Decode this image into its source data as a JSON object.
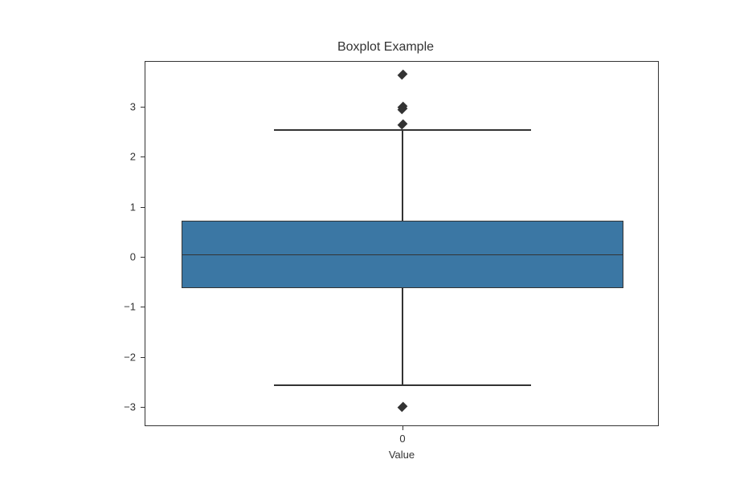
{
  "chart_data": {
    "type": "boxplot",
    "title": "Boxplot Example",
    "xlabel": "Value",
    "ylabel": "",
    "x_tick_labels": [
      "0"
    ],
    "y_ticks": [
      -3,
      -2,
      -1,
      0,
      1,
      2,
      3
    ],
    "ylim": [
      -3.4,
      3.9
    ],
    "series": [
      {
        "name": "0",
        "q1": -0.62,
        "median": 0.05,
        "q3": 0.72,
        "whisker_low": -2.55,
        "whisker_high": 2.55,
        "outliers": [
          -3.0,
          2.65,
          2.95,
          3.0,
          3.65
        ]
      }
    ]
  }
}
